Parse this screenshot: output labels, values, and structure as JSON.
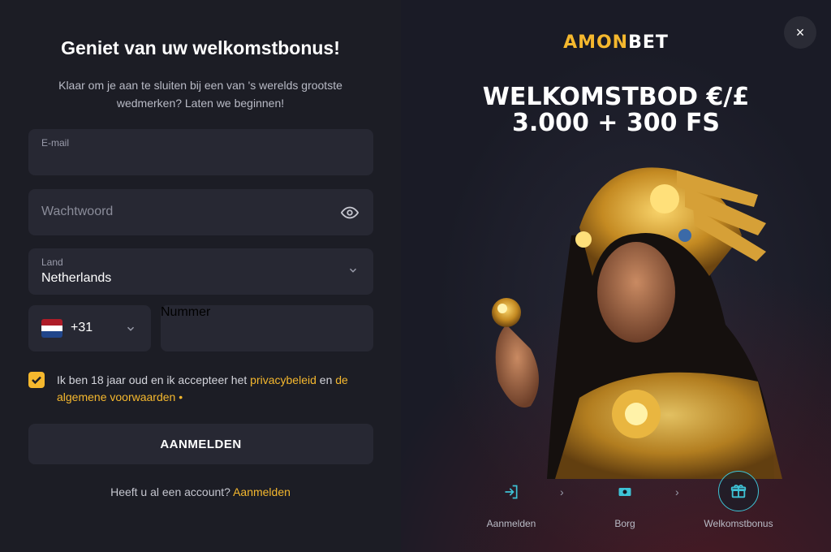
{
  "form": {
    "title": "Geniet van uw welkomstbonus!",
    "subtitle": "Klaar om je aan te sluiten bij een van 's werelds grootste wedmerken? Laten we beginnen!",
    "email_label": "E-mail",
    "email_value": "",
    "password_placeholder": "Wachtwoord",
    "country_label": "Land",
    "country_value": "Netherlands",
    "phone_prefix": "+31",
    "phone_placeholder": "Nummer",
    "consent_text_1": "Ik ben 18 jaar oud en ik accepteer het ",
    "consent_link_1": "privacybeleid",
    "consent_text_2": " en ",
    "consent_link_2": "de algemene voorwaarden",
    "consent_required_marker": " •",
    "consent_checked": true,
    "submit_label": "AANMELDEN",
    "has_account_text": "Heeft u al een account? ",
    "login_link": "Aanmelden"
  },
  "promo": {
    "logo_part1": "AMON",
    "logo_part2": "BET",
    "headline": "WELKOMSTBOD €/£ 3.000 + 300 FS",
    "close_icon": "×",
    "steps": [
      {
        "label": "Aanmelden",
        "icon": "login-icon"
      },
      {
        "label": "Borg",
        "icon": "deposit-icon"
      },
      {
        "label": "Welkomstbonus",
        "icon": "gift-icon"
      }
    ]
  },
  "colors": {
    "accent": "#f5b82e",
    "field_bg": "#272833",
    "panel_bg": "#1c1d25",
    "step_active": "#3ec3d6"
  }
}
